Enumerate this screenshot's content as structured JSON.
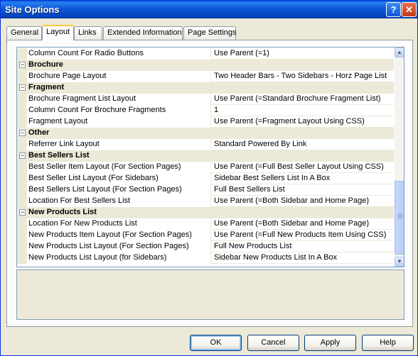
{
  "window": {
    "title": "Site Options"
  },
  "tabs": [
    "General",
    "Layout",
    "Links",
    "Extended Information",
    "Page Settings"
  ],
  "active_tab": "Layout",
  "rows": [
    {
      "type": "prop",
      "name": "Column Count For Radio Buttons",
      "value": "Use Parent (=1)"
    },
    {
      "type": "cat",
      "name": "Brochure",
      "toggle": "⊟"
    },
    {
      "type": "prop",
      "name": "Brochure Page Layout",
      "value": "Two Header Bars - Two Sidebars - Horz Page List"
    },
    {
      "type": "cat",
      "name": "Fragment",
      "toggle": "⊟"
    },
    {
      "type": "prop",
      "name": "Brochure Fragment List Layout",
      "value": "Use Parent (=Standard Brochure Fragment List)"
    },
    {
      "type": "prop",
      "name": "Column Count For Brochure Fragments",
      "value": "1"
    },
    {
      "type": "prop",
      "name": "Fragment Layout",
      "value": "Use Parent (=Fragment Layout Using CSS)"
    },
    {
      "type": "cat",
      "name": "Other",
      "toggle": "⊟"
    },
    {
      "type": "prop",
      "name": "Referrer Link Layout",
      "value": "Standard Powered By Link"
    },
    {
      "type": "cat",
      "name": "Best Sellers List",
      "toggle": "⊟"
    },
    {
      "type": "prop",
      "name": "Best Seller Item Layout (For Section Pages)",
      "value": "Use Parent (=Full Best Seller Layout Using CSS)"
    },
    {
      "type": "prop",
      "name": "Best Seller List Layout (For Sidebars)",
      "value": "Sidebar Best Sellers List In A Box"
    },
    {
      "type": "prop",
      "name": "Best Sellers List Layout (For Section Pages)",
      "value": "Full Best Sellers List"
    },
    {
      "type": "prop",
      "name": "Location For Best Sellers List",
      "value": "Use Parent (=Both Sidebar and Home Page)"
    },
    {
      "type": "cat",
      "name": "New Products List",
      "toggle": "⊟"
    },
    {
      "type": "prop",
      "name": "Location For New Products List",
      "value": "Use Parent (=Both Sidebar and Home Page)"
    },
    {
      "type": "prop",
      "name": "New Products Item Layout (For Section Pages)",
      "value": "Use Parent (=Full New Products Item Using CSS)"
    },
    {
      "type": "prop",
      "name": "New Products List Layout (For Section Pages)",
      "value": "Full New Products List"
    },
    {
      "type": "prop",
      "name": "New Products List Layout (for Sidebars)",
      "value": "Sidebar New Products List In A Box"
    }
  ],
  "scroll_position": 0.62,
  "buttons": {
    "ok": "OK",
    "cancel": "Cancel",
    "apply": "Apply",
    "help": "Help"
  },
  "icons": {
    "help": "?",
    "close": "✕",
    "scroll_up": "▲",
    "scroll_down": "▼"
  },
  "colors": {
    "title_bar": "#0a58d6",
    "active_tab_accent": "#ffc83c",
    "category_bg": "#ece9d8"
  }
}
